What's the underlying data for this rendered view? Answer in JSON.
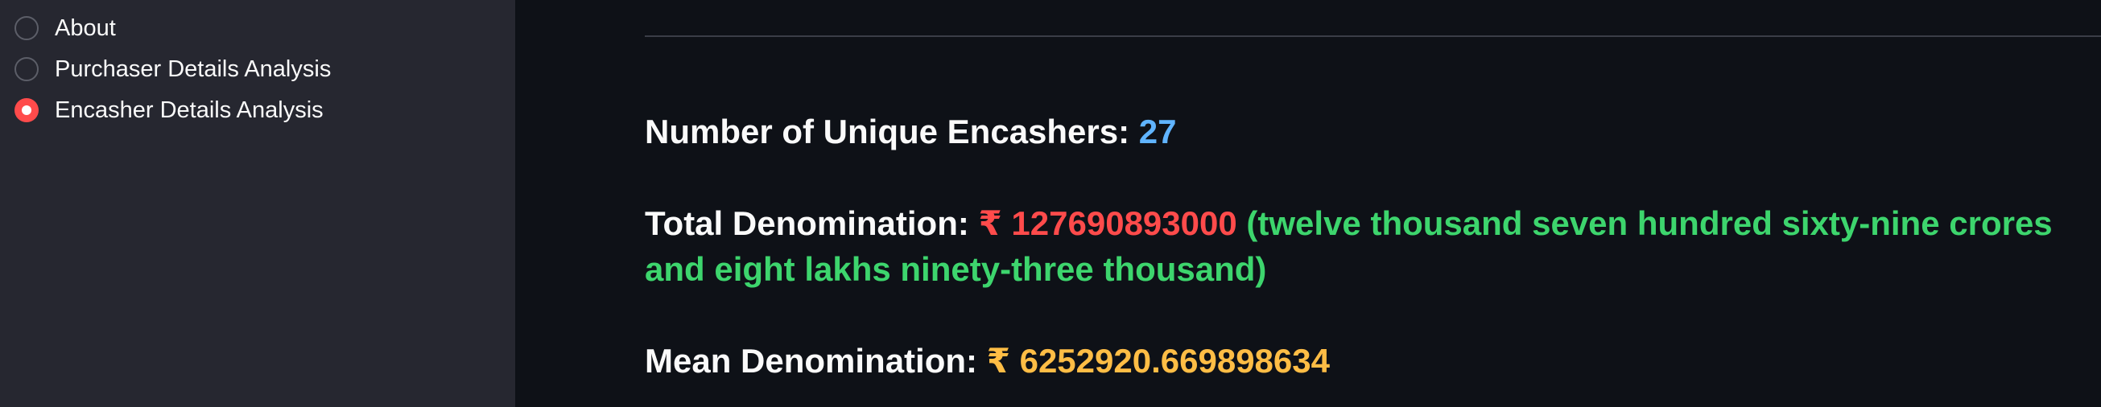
{
  "sidebar": {
    "radio_options": [
      {
        "label": "About",
        "selected": false
      },
      {
        "label": "Purchaser Details Analysis",
        "selected": false
      },
      {
        "label": "Encasher Details Analysis",
        "selected": true
      }
    ],
    "accent_color": "#ff4b4b"
  },
  "main": {
    "unique_encashers": {
      "label": "Number of Unique Encashers:",
      "value": "27"
    },
    "total_denomination": {
      "label": "Total Denomination:",
      "value": "₹ 127690893000",
      "words": "(twelve thousand seven hundred sixty-nine crores and eight lakhs ninety-three thousand)"
    },
    "mean_denomination": {
      "label": "Mean Denomination:",
      "value": "₹ 6252920.669898634"
    }
  },
  "colors": {
    "background": "#0e1117",
    "sidebar_background": "#262730",
    "blue_value": "#60b4ff",
    "red_value": "#ff4b4b",
    "green_value": "#3dd56d",
    "yellow_value": "#ffbd45"
  }
}
